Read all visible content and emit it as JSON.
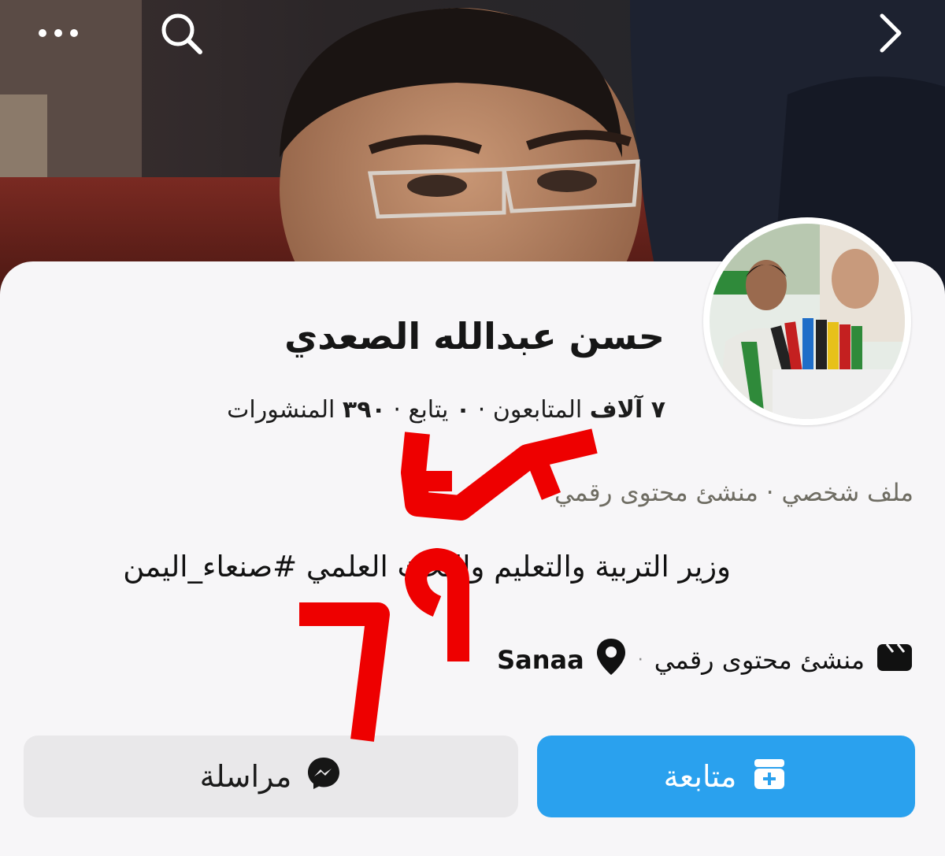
{
  "profile": {
    "name": "حسن عبدالله الصعدي",
    "stats": {
      "followers_value": "٧ آلاف",
      "followers_label": "المتابعون",
      "following_value": "٠",
      "following_label": "يتابع",
      "posts_value": "٣٩٠",
      "posts_label": "المنشورات",
      "separator": "·"
    },
    "category": "ملف شخصي · منشئ محتوى رقمي",
    "bio": "وزير التربية والتعليم والبحث العلمي #صنعاء_اليمن",
    "meta": {
      "creator_label": "منشئ محتوى رقمي",
      "separator": "·",
      "location": "Sanaa"
    }
  },
  "actions": {
    "follow_label": "متابعة",
    "message_label": "مراسلة"
  },
  "topbar": {
    "icons": [
      "more-icon",
      "search-icon",
      "chevron-right-icon"
    ]
  },
  "watermark_text": "مزور",
  "colors": {
    "accent": "#2aa1ee",
    "watermark": "#ee0000",
    "card_bg": "#f7f6f8"
  }
}
